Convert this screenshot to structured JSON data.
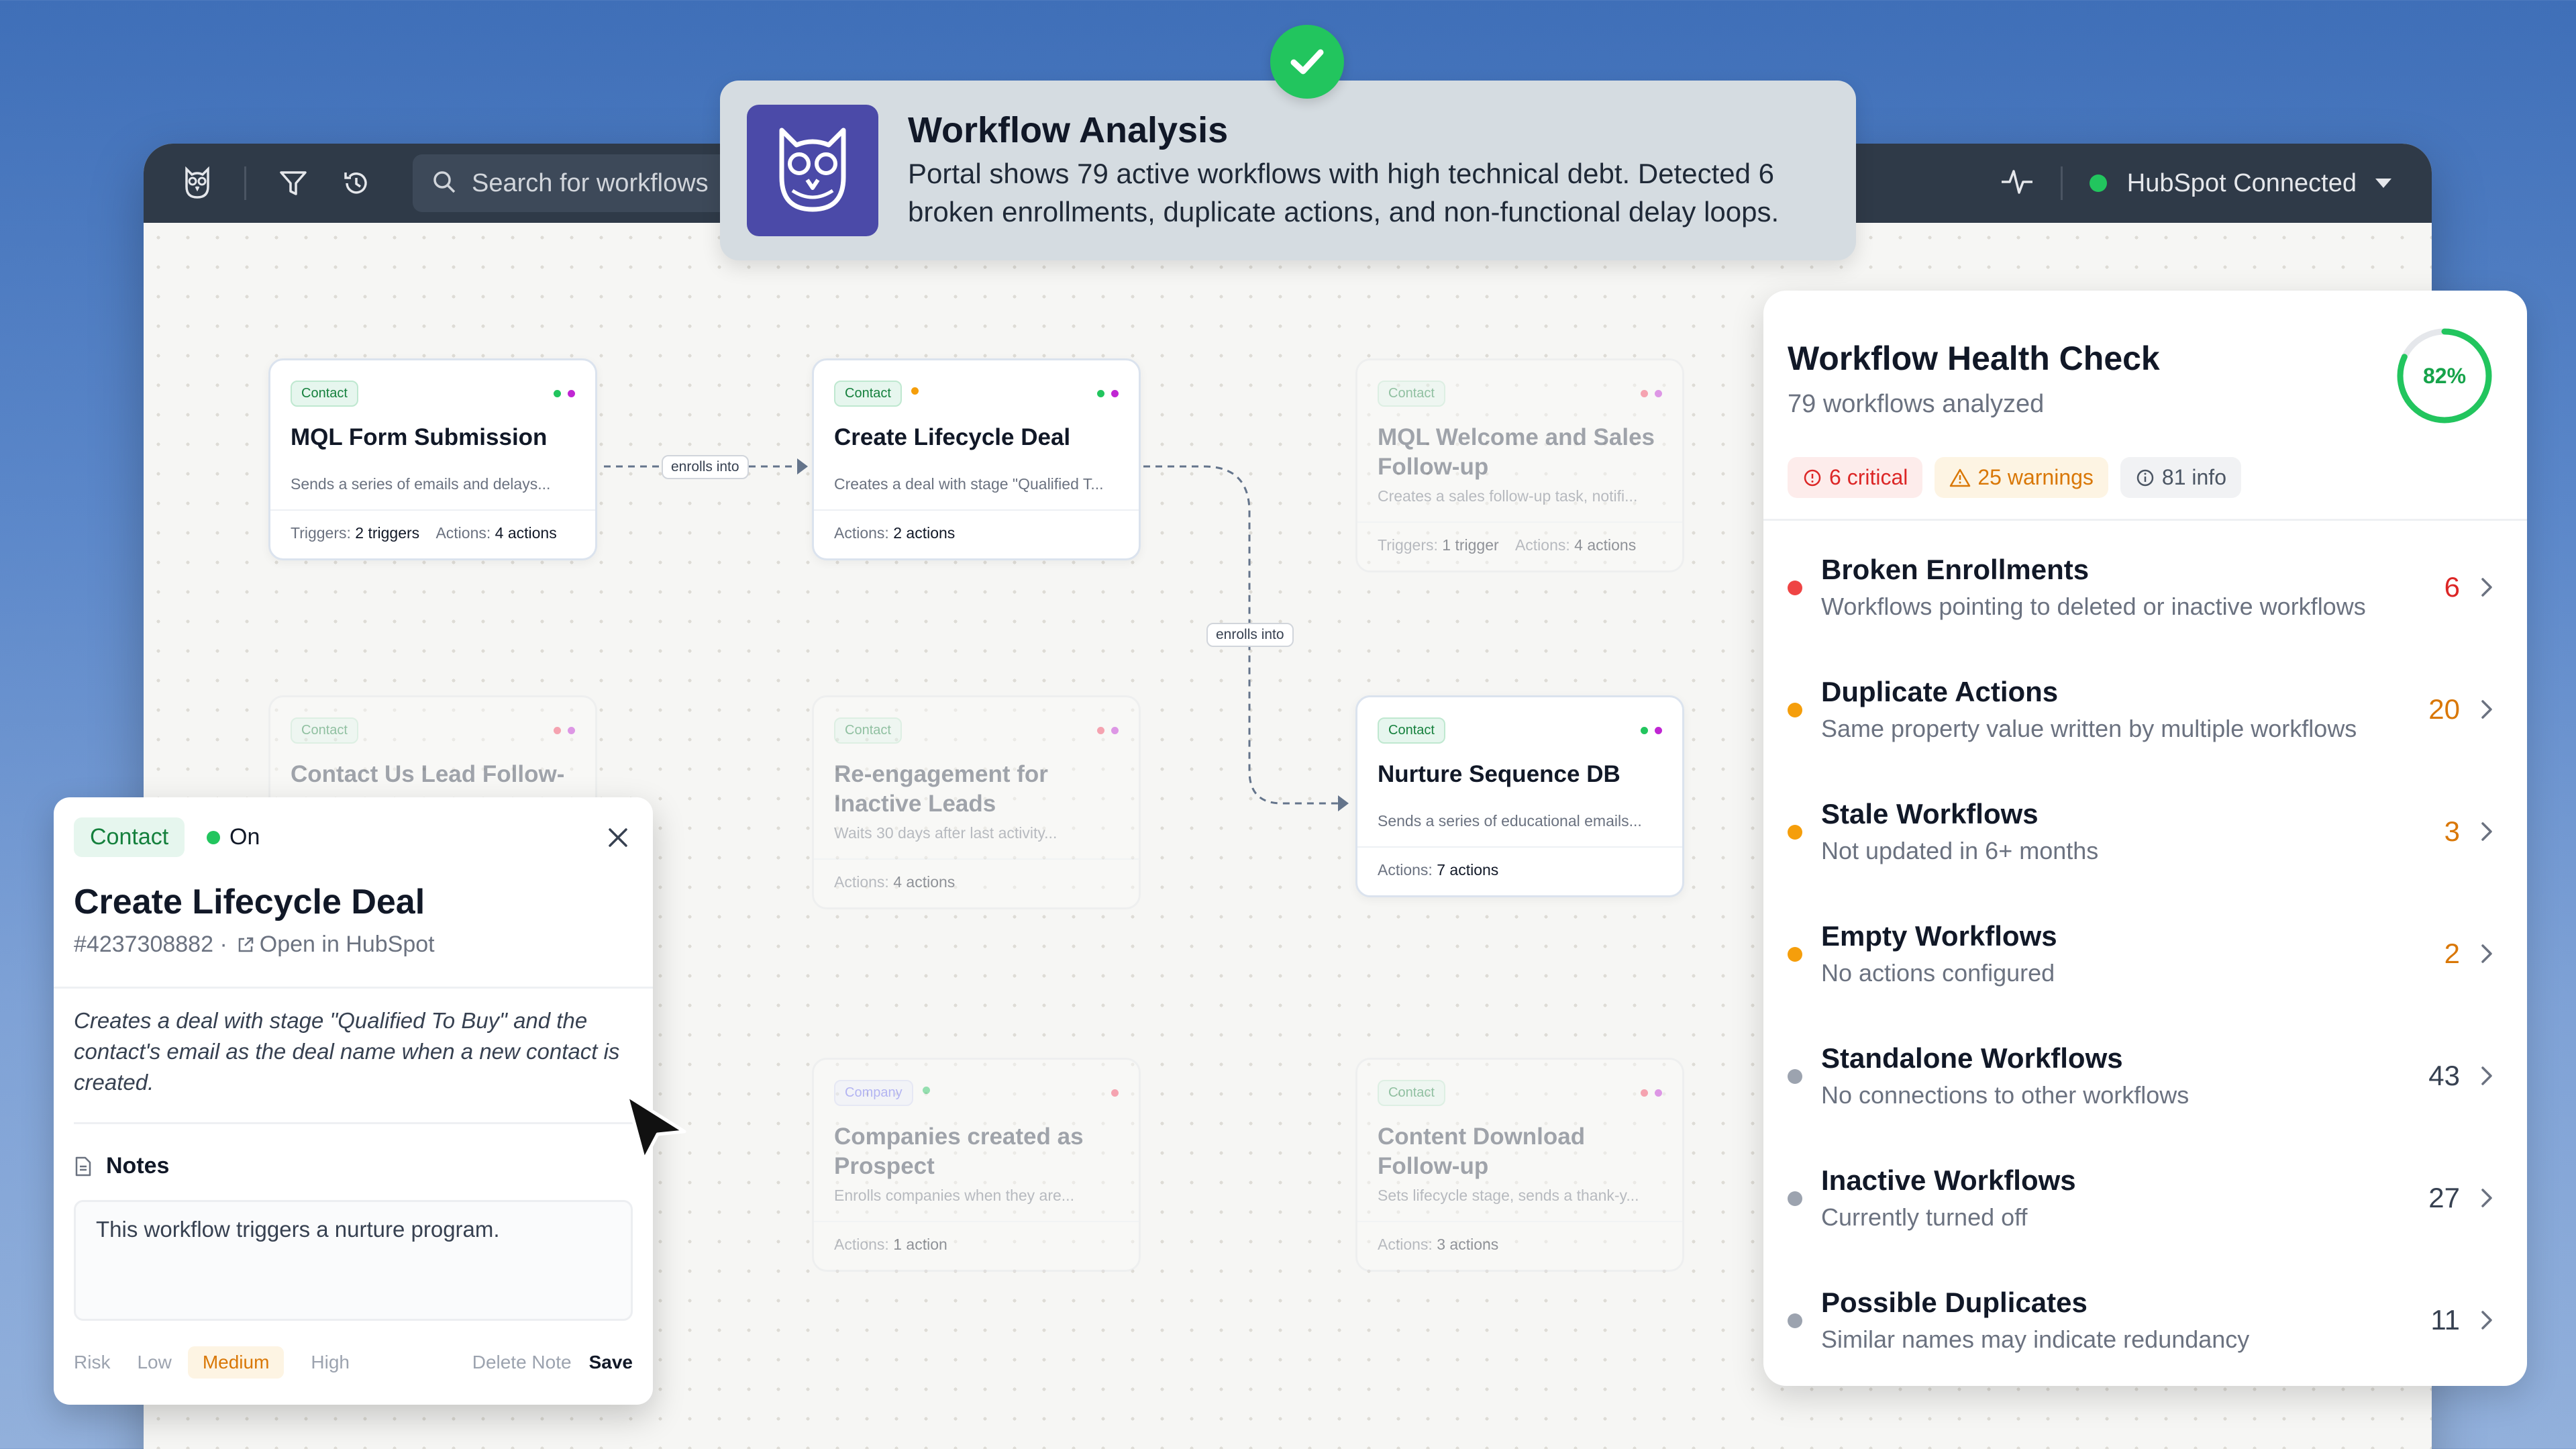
{
  "topbar": {
    "search_placeholder": "Search for workflows",
    "connection_status": "HubSpot Connected"
  },
  "banner": {
    "title": "Workflow Analysis",
    "body_line1": "Portal shows 79 active workflows with high technical debt. Detected 6",
    "body_line2": "broken enrollments, duplicate actions, and non-functional delay loops."
  },
  "connectors": {
    "label1": "enrolls into",
    "label2": "enrolls into"
  },
  "workflows": [
    {
      "badge": "Contact",
      "title": "MQL Form Submission",
      "desc": "Sends a series of emails and delays...",
      "triggers_label": "Triggers:",
      "triggers": "2 triggers",
      "actions_label": "Actions:",
      "actions": "4 actions"
    },
    {
      "badge": "Contact",
      "title": "Create Lifecycle Deal",
      "desc": "Creates a deal with stage \"Qualified T...",
      "actions_label": "Actions:",
      "actions": "2 actions"
    },
    {
      "badge": "Contact",
      "title": "MQL Welcome and Sales Follow-up",
      "desc": "Creates a sales follow-up task, notifi...",
      "triggers_label": "Triggers:",
      "triggers": "1 trigger",
      "actions_label": "Actions:",
      "actions": "4 actions"
    },
    {
      "badge": "Contact",
      "title": "Contact Us Lead Follow-up"
    },
    {
      "badge": "Contact",
      "title": "Re-engagement for Inactive Leads",
      "desc": "Waits 30 days after last activity...",
      "actions_label": "Actions:",
      "actions": "4 actions"
    },
    {
      "badge": "Contact",
      "title": "Nurture Sequence DB",
      "desc": "Sends a series of educational emails...",
      "actions_label": "Actions:",
      "actions": "7 actions"
    },
    {
      "badge": "Company",
      "title": "Companies created as Prospect",
      "desc": "Enrolls companies when they are...",
      "actions_label": "Actions:",
      "actions": "1 action"
    },
    {
      "badge": "Contact",
      "title": "Content Download Follow-up",
      "desc": "Sets lifecycle stage, sends a thank-y...",
      "actions_label": "Actions:",
      "actions": "3 actions"
    }
  ],
  "health": {
    "title": "Workflow Health Check",
    "subtitle": "79 workflows analyzed",
    "score": "82%",
    "score_value": 0.82,
    "chips": {
      "critical": "6 critical",
      "warnings": "25 warnings",
      "info": "81 info"
    },
    "items": [
      {
        "name": "Broken Enrollments",
        "desc": "Workflows pointing to deleted or inactive workflows",
        "count": "6",
        "severity": "critical"
      },
      {
        "name": "Duplicate Actions",
        "desc": "Same property value written by multiple workflows",
        "count": "20",
        "severity": "warning"
      },
      {
        "name": "Stale Workflows",
        "desc": "Not updated in 6+ months",
        "count": "3",
        "severity": "warning"
      },
      {
        "name": "Empty Workflows",
        "desc": "No actions configured",
        "count": "2",
        "severity": "warning"
      },
      {
        "name": "Standalone Workflows",
        "desc": "No connections to other workflows",
        "count": "43",
        "severity": "info"
      },
      {
        "name": "Inactive Workflows",
        "desc": "Currently turned off",
        "count": "27",
        "severity": "info"
      },
      {
        "name": "Possible Duplicates",
        "desc": "Similar names may indicate redundancy",
        "count": "11",
        "severity": "info"
      }
    ]
  },
  "detail": {
    "badge": "Contact",
    "status": "On",
    "title": "Create Lifecycle Deal",
    "id": "#4237308882 ·",
    "open_link": "Open in HubSpot",
    "description": "Creates a deal with stage \"Qualified To Buy\" and the contact's email as the deal name when a new contact is created.",
    "notes_heading": "Notes",
    "notes_text": "This workflow triggers a nurture program.",
    "risk_label": "Risk",
    "risk_low": "Low",
    "risk_medium": "Medium",
    "risk_high": "High",
    "delete_note": "Delete Note",
    "save": "Save"
  },
  "colors": {
    "critical": "#ef4444",
    "warning": "#f59e0b",
    "info": "#9ca3af",
    "accent_green": "#22c55e",
    "topbar": "#2f3a48",
    "brand_purple": "#4b4aa8"
  }
}
